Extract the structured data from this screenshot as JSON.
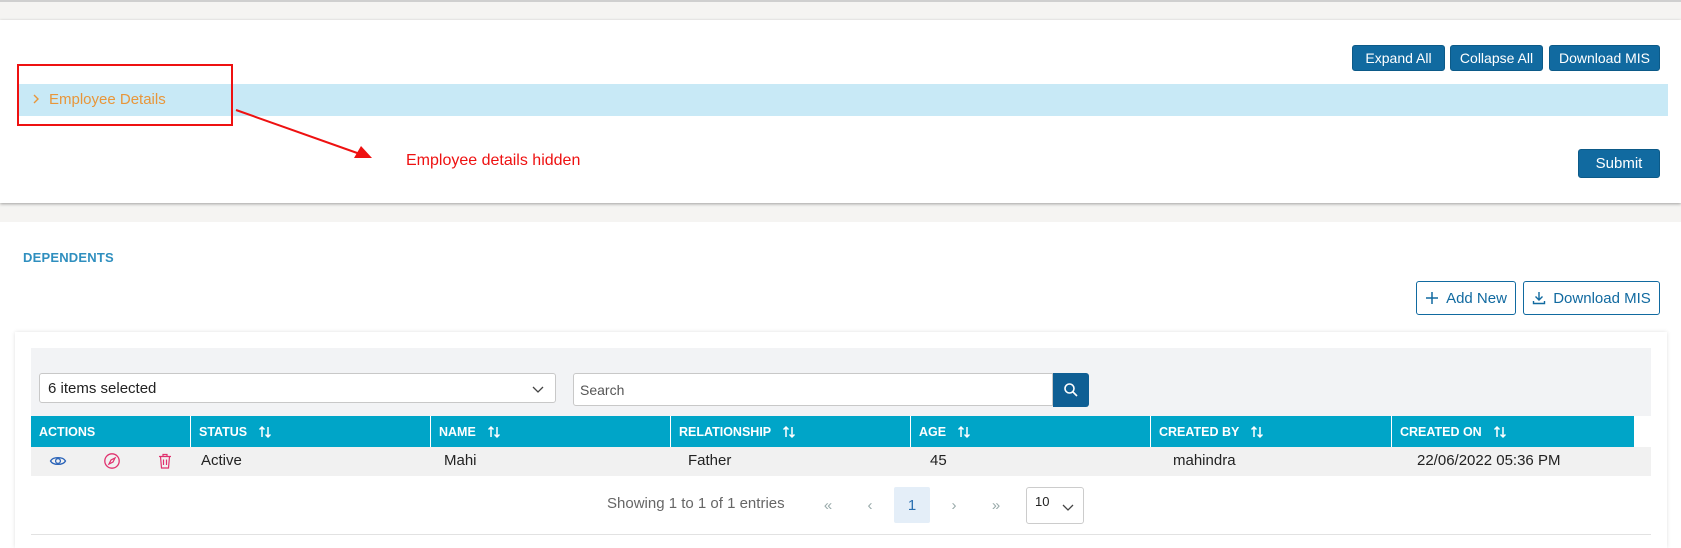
{
  "top_buttons": {
    "expand_all": "Expand All",
    "collapse_all": "Collapse All",
    "download_mis": "Download MIS"
  },
  "accordion": {
    "employee_details": "Employee Details"
  },
  "annotation": "Employee details hidden",
  "submit_label": "Submit",
  "dependents": {
    "title": "DEPENDENTS",
    "add_new": "Add New",
    "download_mis": "Download MIS",
    "selected_filter": "6 items selected",
    "search_placeholder": "Search",
    "columns": [
      "ACTIONS",
      "STATUS",
      "NAME",
      "RELATIONSHIP",
      "AGE",
      "CREATED BY",
      "CREATED ON"
    ],
    "rows": [
      {
        "status": "Active",
        "name": "Mahi",
        "relationship": "Father",
        "age": "45",
        "created_by": "mahindra",
        "created_on": "22/06/2022 05:36 PM"
      }
    ],
    "pagination": {
      "summary": "Showing 1 to 1 of 1 entries",
      "first": "«",
      "prev": "‹",
      "current": "1",
      "next": "›",
      "last": "»",
      "page_size": "10"
    }
  },
  "colors": {
    "primary": "#116aa0",
    "header_teal": "#00a5c8",
    "accordion_bg": "#c8e9f6",
    "accordion_text": "#e8963a",
    "annotation_red": "#ee1111"
  },
  "icons": [
    "chevron-right-icon",
    "plus-icon",
    "download-icon",
    "chevron-down-icon",
    "search-icon",
    "sort-icon",
    "eye-icon",
    "compass-icon",
    "trash-icon"
  ]
}
